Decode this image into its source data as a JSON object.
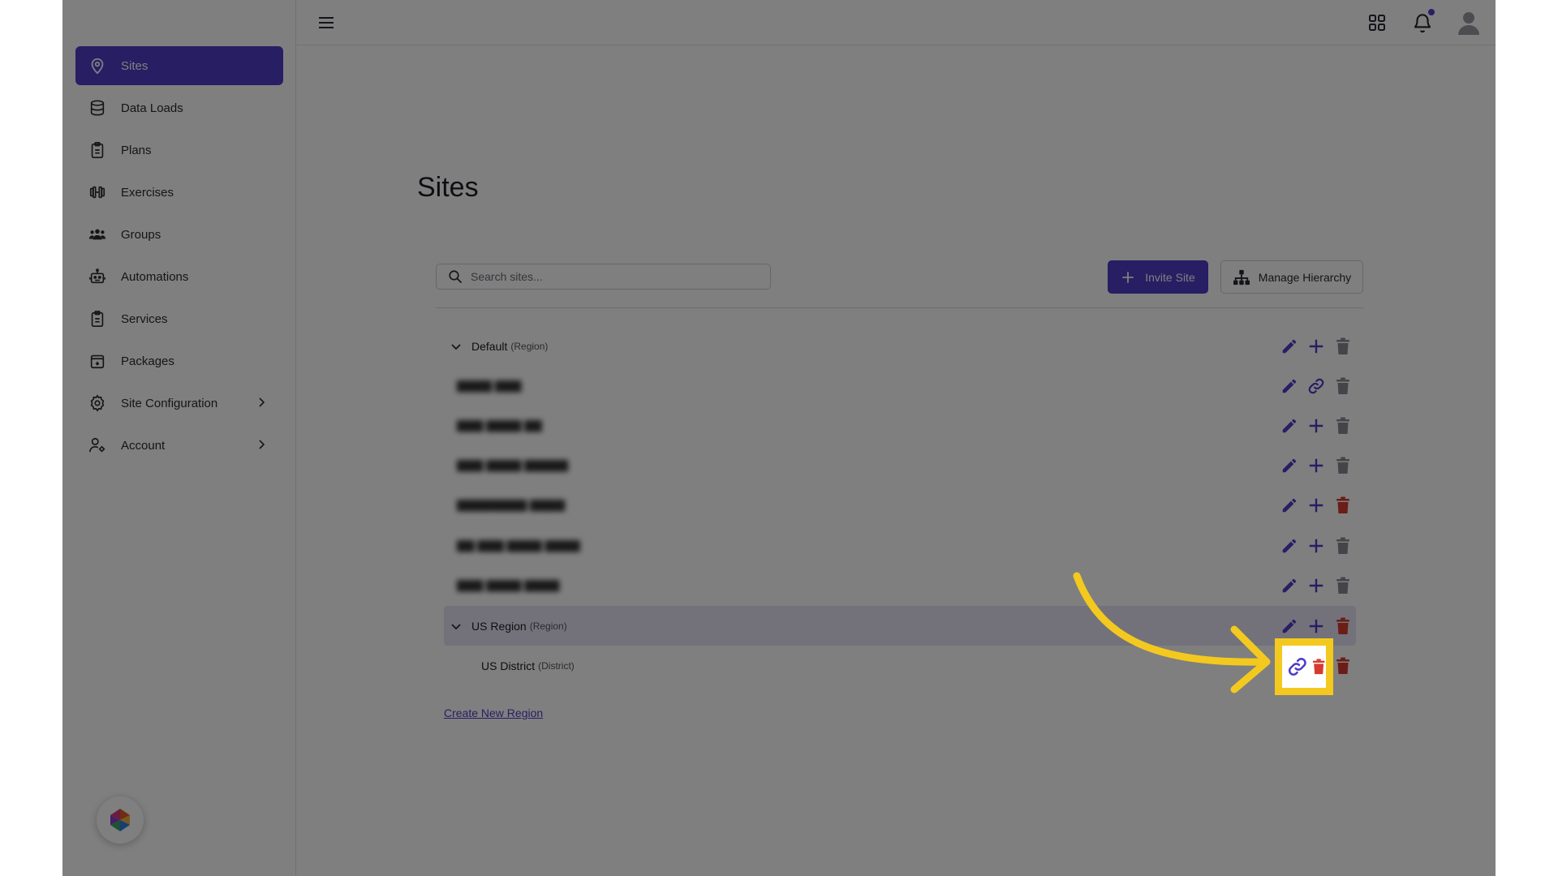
{
  "sidebar": {
    "items": [
      {
        "label": "Sites",
        "icon": "map-pin-icon",
        "active": true
      },
      {
        "label": "Data Loads",
        "icon": "database-icon"
      },
      {
        "label": "Plans",
        "icon": "clipboard-icon"
      },
      {
        "label": "Exercises",
        "icon": "dumbbell-icon"
      },
      {
        "label": "Groups",
        "icon": "users-icon"
      },
      {
        "label": "Automations",
        "icon": "robot-icon"
      },
      {
        "label": "Services",
        "icon": "clipboard-icon"
      },
      {
        "label": "Packages",
        "icon": "package-icon"
      },
      {
        "label": "Site Configuration",
        "icon": "gear-icon",
        "has_submenu": true
      },
      {
        "label": "Account",
        "icon": "user-gear-icon",
        "has_submenu": true
      }
    ]
  },
  "topbar": {
    "icons": [
      "hamburger-menu-icon",
      "apps-grid-icon",
      "bell-icon",
      "user-avatar-icon"
    ]
  },
  "main": {
    "title": "Sites",
    "search": {
      "placeholder": "Search sites...",
      "value": ""
    },
    "invite_label": "Invite Site",
    "manage_label": "Manage Hierarchy",
    "create_region_label": "Create New Region",
    "tree": [
      {
        "name": "Default",
        "type": "(Region)",
        "expanded": true,
        "second_action": "plus",
        "delete_color": "gray"
      },
      {
        "name": "▇▇▇▇ ▇▇▇",
        "blurred": true,
        "second_action": "link",
        "delete_color": "gray"
      },
      {
        "name": "▇▇▇ ▇▇▇▇ ▇▇",
        "blurred": true,
        "second_action": "plus",
        "delete_color": "gray"
      },
      {
        "name": "▇▇▇ ▇▇▇▇ ▇▇▇▇▇",
        "blurred": true,
        "second_action": "plus",
        "delete_color": "gray"
      },
      {
        "name": "▇▇▇▇▇▇▇▇ ▇▇▇▇",
        "blurred": true,
        "second_action": "plus",
        "delete_color": "red"
      },
      {
        "name": "▇▇ ▇▇▇ ▇▇▇▇ ▇▇▇▇",
        "blurred": true,
        "second_action": "plus",
        "delete_color": "gray"
      },
      {
        "name": "▇▇▇ ▇▇▇▇ ▇▇▇▇",
        "blurred": true,
        "second_action": "plus",
        "delete_color": "gray"
      },
      {
        "name": "US Region",
        "type": "(Region)",
        "expanded": true,
        "second_action": "plus",
        "delete_color": "red"
      },
      {
        "name": "US District",
        "type": "(District)",
        "second_action": "link",
        "delete_color": "red"
      }
    ]
  },
  "colors": {
    "accent": "#4f3cc9",
    "danger": "#d63a2f",
    "muted_icon": "#8a8a92",
    "callout": "#f4c91f"
  }
}
